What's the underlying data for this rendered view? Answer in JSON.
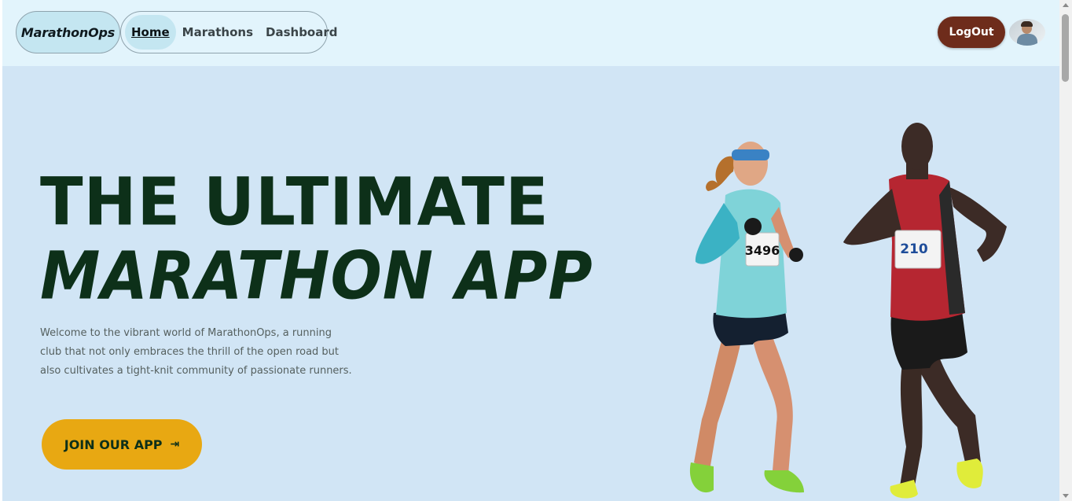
{
  "navbar": {
    "brand": "MarathonOps",
    "links": [
      {
        "label": "Home",
        "active": true
      },
      {
        "label": "Marathons",
        "active": false
      },
      {
        "label": "Dashboard",
        "active": false
      }
    ],
    "logout_label": "LogOut",
    "avatar_icon": "user-avatar"
  },
  "hero": {
    "title_line1": "THE ULTIMATE",
    "title_line2": "MARATHON APP",
    "description": "Welcome to the vibrant world of MarathonOps, a running club that not only embraces the thrill of the open road but also cultivates a tight-knit community of passionate runners.",
    "cta_label": "JOIN OUR APP",
    "cta_icon": "arrow-right-to-bar-icon",
    "bib_left": "3496",
    "bib_right": "210"
  },
  "colors": {
    "nav_bg": "#e2f4fc",
    "hero_bg": "#d1e5f5",
    "title": "#0d3019",
    "cta": "#e8a812",
    "logout": "#6e2c1b"
  }
}
